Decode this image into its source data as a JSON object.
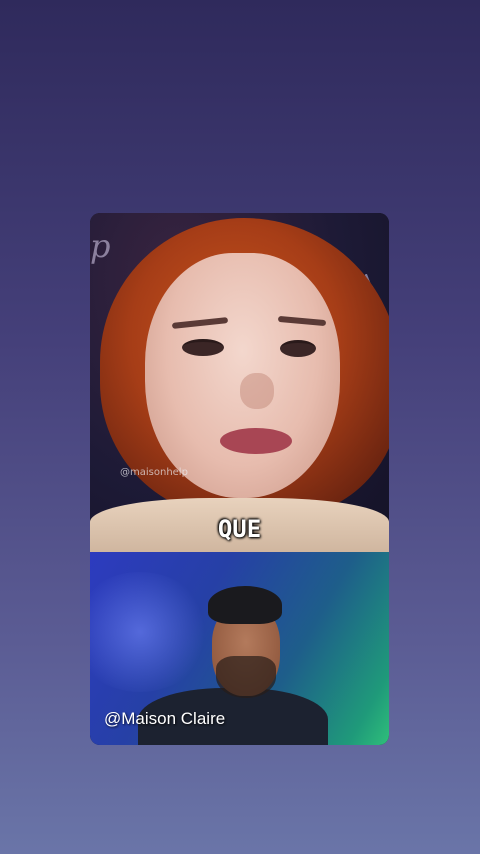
{
  "top_clip": {
    "watermark": "@maisonhelp",
    "caption": "QUE",
    "backdrop_text_left": "p",
    "backdrop_text_right": "NA"
  },
  "bottom_clip": {
    "handle": "@Maison Claire"
  },
  "colors": {
    "background_top": "#2f2a5c",
    "background_bottom": "#6a75a8",
    "caption": "#ffffff"
  }
}
